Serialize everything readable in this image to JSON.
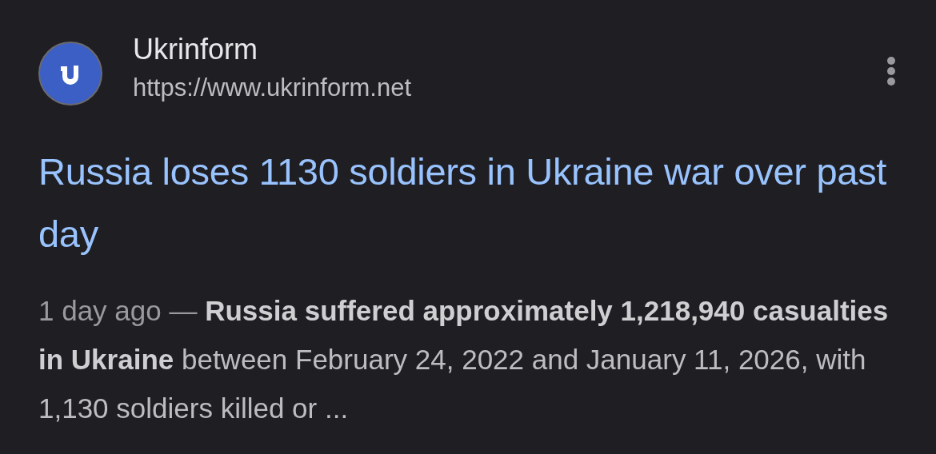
{
  "result": {
    "source": {
      "name": "Ukrinform",
      "url": "https://www.ukrinform.net"
    },
    "title": "Russia loses 1130 soldiers in Ukraine war over past day",
    "snippet": {
      "date": "1 day ago",
      "separator": "—",
      "text": "**Russia suffered approximately 1,218,940 casualties in Ukraine** between February 24, 2022 and January 11, 2026, with 1,130 soldiers killed or ..."
    }
  }
}
